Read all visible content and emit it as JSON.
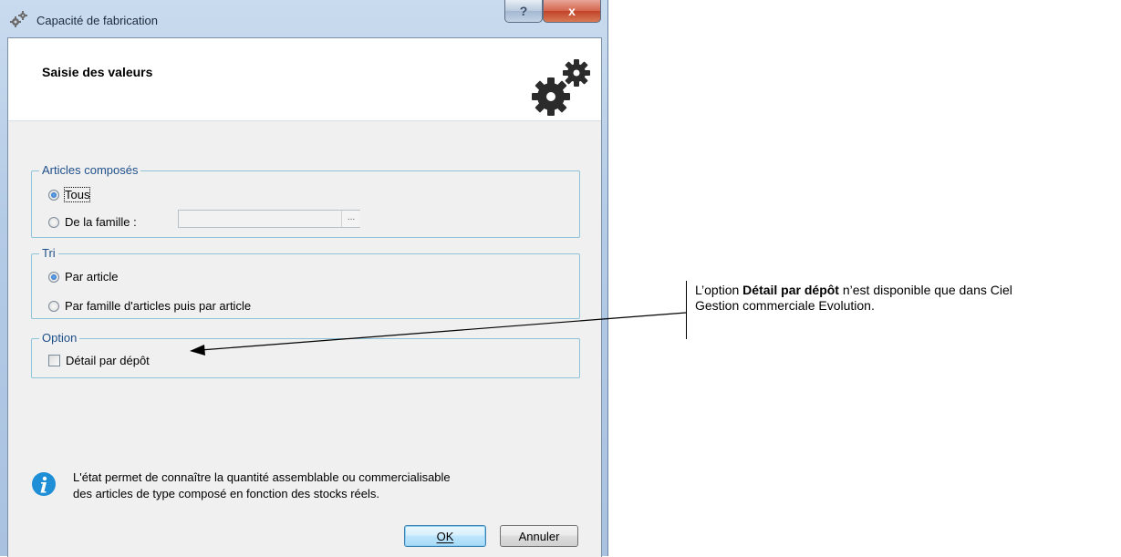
{
  "window": {
    "title": "Capacité de fabrication",
    "help_button": "?",
    "close_button": "x"
  },
  "header": {
    "title": "Saisie des valeurs",
    "icon": "gears-icon"
  },
  "articles_group": {
    "legend": "Articles composés",
    "options": [
      {
        "label": "Tous",
        "checked": true
      },
      {
        "label": "De la famille :",
        "checked": false
      }
    ],
    "famille_value": "",
    "browse_label": "..."
  },
  "tri_group": {
    "legend": "Tri",
    "options": [
      {
        "label": "Par article",
        "checked": true
      },
      {
        "label": "Par famille d'articles puis par article",
        "checked": false
      }
    ]
  },
  "option_group": {
    "legend": "Option",
    "detail_label": "Détail par dépôt",
    "detail_checked": false
  },
  "info": {
    "line1": "L'état permet de connaître la quantité assemblable ou commercialisable",
    "line2": "des articles de type composé en fonction des stocks réels."
  },
  "buttons": {
    "ok": "OK",
    "cancel": "Annuler"
  },
  "annotation": {
    "prefix": "L’option ",
    "bold": "Détail par dépôt",
    "suffix": " n’est disponible que dans Ciel",
    "line2": "Gestion commerciale Evolution."
  },
  "colors": {
    "legend": "#1d4f8a",
    "group_border": "#8fc3d8",
    "info_icon": "#1e8fd6"
  }
}
